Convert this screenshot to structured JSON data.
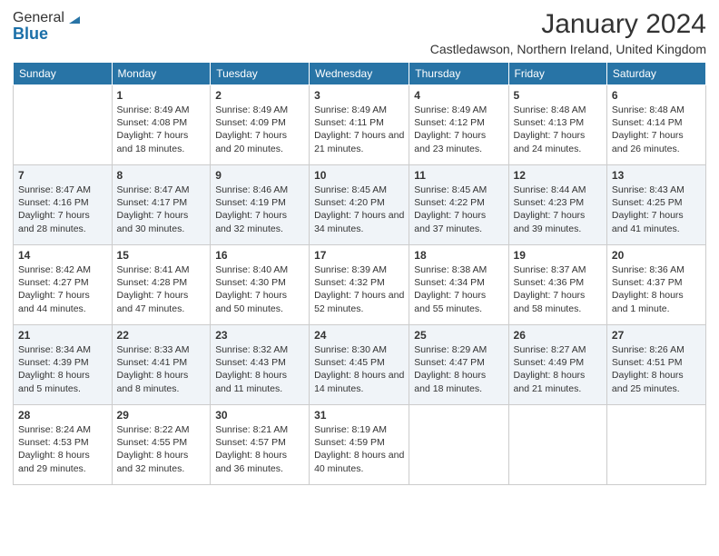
{
  "logo": {
    "general": "General",
    "blue": "Blue"
  },
  "header": {
    "month": "January 2024",
    "location": "Castledawson, Northern Ireland, United Kingdom"
  },
  "weekdays": [
    "Sunday",
    "Monday",
    "Tuesday",
    "Wednesday",
    "Thursday",
    "Friday",
    "Saturday"
  ],
  "weeks": [
    [
      {
        "day": "",
        "sunrise": "",
        "sunset": "",
        "daylight": ""
      },
      {
        "day": "1",
        "sunrise": "Sunrise: 8:49 AM",
        "sunset": "Sunset: 4:08 PM",
        "daylight": "Daylight: 7 hours and 18 minutes."
      },
      {
        "day": "2",
        "sunrise": "Sunrise: 8:49 AM",
        "sunset": "Sunset: 4:09 PM",
        "daylight": "Daylight: 7 hours and 20 minutes."
      },
      {
        "day": "3",
        "sunrise": "Sunrise: 8:49 AM",
        "sunset": "Sunset: 4:11 PM",
        "daylight": "Daylight: 7 hours and 21 minutes."
      },
      {
        "day": "4",
        "sunrise": "Sunrise: 8:49 AM",
        "sunset": "Sunset: 4:12 PM",
        "daylight": "Daylight: 7 hours and 23 minutes."
      },
      {
        "day": "5",
        "sunrise": "Sunrise: 8:48 AM",
        "sunset": "Sunset: 4:13 PM",
        "daylight": "Daylight: 7 hours and 24 minutes."
      },
      {
        "day": "6",
        "sunrise": "Sunrise: 8:48 AM",
        "sunset": "Sunset: 4:14 PM",
        "daylight": "Daylight: 7 hours and 26 minutes."
      }
    ],
    [
      {
        "day": "7",
        "sunrise": "Sunrise: 8:47 AM",
        "sunset": "Sunset: 4:16 PM",
        "daylight": "Daylight: 7 hours and 28 minutes."
      },
      {
        "day": "8",
        "sunrise": "Sunrise: 8:47 AM",
        "sunset": "Sunset: 4:17 PM",
        "daylight": "Daylight: 7 hours and 30 minutes."
      },
      {
        "day": "9",
        "sunrise": "Sunrise: 8:46 AM",
        "sunset": "Sunset: 4:19 PM",
        "daylight": "Daylight: 7 hours and 32 minutes."
      },
      {
        "day": "10",
        "sunrise": "Sunrise: 8:45 AM",
        "sunset": "Sunset: 4:20 PM",
        "daylight": "Daylight: 7 hours and 34 minutes."
      },
      {
        "day": "11",
        "sunrise": "Sunrise: 8:45 AM",
        "sunset": "Sunset: 4:22 PM",
        "daylight": "Daylight: 7 hours and 37 minutes."
      },
      {
        "day": "12",
        "sunrise": "Sunrise: 8:44 AM",
        "sunset": "Sunset: 4:23 PM",
        "daylight": "Daylight: 7 hours and 39 minutes."
      },
      {
        "day": "13",
        "sunrise": "Sunrise: 8:43 AM",
        "sunset": "Sunset: 4:25 PM",
        "daylight": "Daylight: 7 hours and 41 minutes."
      }
    ],
    [
      {
        "day": "14",
        "sunrise": "Sunrise: 8:42 AM",
        "sunset": "Sunset: 4:27 PM",
        "daylight": "Daylight: 7 hours and 44 minutes."
      },
      {
        "day": "15",
        "sunrise": "Sunrise: 8:41 AM",
        "sunset": "Sunset: 4:28 PM",
        "daylight": "Daylight: 7 hours and 47 minutes."
      },
      {
        "day": "16",
        "sunrise": "Sunrise: 8:40 AM",
        "sunset": "Sunset: 4:30 PM",
        "daylight": "Daylight: 7 hours and 50 minutes."
      },
      {
        "day": "17",
        "sunrise": "Sunrise: 8:39 AM",
        "sunset": "Sunset: 4:32 PM",
        "daylight": "Daylight: 7 hours and 52 minutes."
      },
      {
        "day": "18",
        "sunrise": "Sunrise: 8:38 AM",
        "sunset": "Sunset: 4:34 PM",
        "daylight": "Daylight: 7 hours and 55 minutes."
      },
      {
        "day": "19",
        "sunrise": "Sunrise: 8:37 AM",
        "sunset": "Sunset: 4:36 PM",
        "daylight": "Daylight: 7 hours and 58 minutes."
      },
      {
        "day": "20",
        "sunrise": "Sunrise: 8:36 AM",
        "sunset": "Sunset: 4:37 PM",
        "daylight": "Daylight: 8 hours and 1 minute."
      }
    ],
    [
      {
        "day": "21",
        "sunrise": "Sunrise: 8:34 AM",
        "sunset": "Sunset: 4:39 PM",
        "daylight": "Daylight: 8 hours and 5 minutes."
      },
      {
        "day": "22",
        "sunrise": "Sunrise: 8:33 AM",
        "sunset": "Sunset: 4:41 PM",
        "daylight": "Daylight: 8 hours and 8 minutes."
      },
      {
        "day": "23",
        "sunrise": "Sunrise: 8:32 AM",
        "sunset": "Sunset: 4:43 PM",
        "daylight": "Daylight: 8 hours and 11 minutes."
      },
      {
        "day": "24",
        "sunrise": "Sunrise: 8:30 AM",
        "sunset": "Sunset: 4:45 PM",
        "daylight": "Daylight: 8 hours and 14 minutes."
      },
      {
        "day": "25",
        "sunrise": "Sunrise: 8:29 AM",
        "sunset": "Sunset: 4:47 PM",
        "daylight": "Daylight: 8 hours and 18 minutes."
      },
      {
        "day": "26",
        "sunrise": "Sunrise: 8:27 AM",
        "sunset": "Sunset: 4:49 PM",
        "daylight": "Daylight: 8 hours and 21 minutes."
      },
      {
        "day": "27",
        "sunrise": "Sunrise: 8:26 AM",
        "sunset": "Sunset: 4:51 PM",
        "daylight": "Daylight: 8 hours and 25 minutes."
      }
    ],
    [
      {
        "day": "28",
        "sunrise": "Sunrise: 8:24 AM",
        "sunset": "Sunset: 4:53 PM",
        "daylight": "Daylight: 8 hours and 29 minutes."
      },
      {
        "day": "29",
        "sunrise": "Sunrise: 8:22 AM",
        "sunset": "Sunset: 4:55 PM",
        "daylight": "Daylight: 8 hours and 32 minutes."
      },
      {
        "day": "30",
        "sunrise": "Sunrise: 8:21 AM",
        "sunset": "Sunset: 4:57 PM",
        "daylight": "Daylight: 8 hours and 36 minutes."
      },
      {
        "day": "31",
        "sunrise": "Sunrise: 8:19 AM",
        "sunset": "Sunset: 4:59 PM",
        "daylight": "Daylight: 8 hours and 40 minutes."
      },
      {
        "day": "",
        "sunrise": "",
        "sunset": "",
        "daylight": ""
      },
      {
        "day": "",
        "sunrise": "",
        "sunset": "",
        "daylight": ""
      },
      {
        "day": "",
        "sunrise": "",
        "sunset": "",
        "daylight": ""
      }
    ]
  ]
}
